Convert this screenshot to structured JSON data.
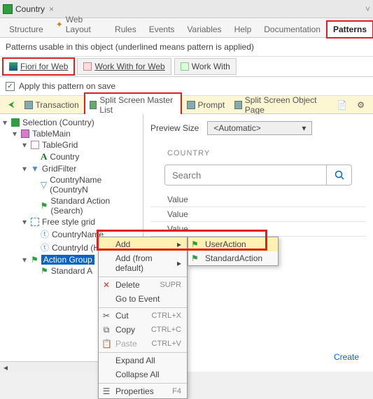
{
  "window": {
    "title": "Country",
    "close": "×",
    "collapse": "˅"
  },
  "tabs": {
    "items": [
      "Structure",
      "Web Layout",
      "Rules",
      "Events",
      "Variables",
      "Help",
      "Documentation",
      "Patterns"
    ],
    "active": "Patterns"
  },
  "patterns": {
    "hint": "Patterns usable in this object (underlined means pattern is applied)",
    "items": [
      {
        "label": "Fiori for Web",
        "active": true,
        "underlined": true
      },
      {
        "label": "Work With for Web",
        "active": false,
        "underlined": false
      },
      {
        "label": "Work With",
        "active": false,
        "underlined": false
      }
    ],
    "apply": {
      "checked": true,
      "label": "Apply this pattern on save"
    }
  },
  "toolbar": {
    "items": [
      "Transaction",
      "Split Screen Master List",
      "Prompt",
      "Split Screen Object Page"
    ]
  },
  "tree": {
    "root": "Selection (Country)",
    "n1": "TableMain",
    "n2": "TableGrid",
    "n3": "Country",
    "n4": "GridFilter",
    "n5": "CountryName (CountryN",
    "n6": "Standard Action (Search)",
    "n7": "Free style grid",
    "n8": "CountryName",
    "n9": "CountryId (Hidden)",
    "n10": "Action Group",
    "n11": "Standard A"
  },
  "context": {
    "add": "Add",
    "add_default": "Add (from default)",
    "delete": "Delete",
    "delete_sc": "SUPR",
    "goto": "Go to Event",
    "cut": "Cut",
    "cut_sc": "CTRL+X",
    "copy": "Copy",
    "copy_sc": "CTRL+C",
    "paste": "Paste",
    "paste_sc": "CTRL+V",
    "expand": "Expand All",
    "collapse": "Collapse All",
    "props": "Properties",
    "props_sc": "F4"
  },
  "submenu": {
    "user": "UserAction",
    "std": "StandardAction"
  },
  "preview": {
    "sizelbl": "Preview Size",
    "sizeval": "<Automatic>",
    "section": "COUNTRY",
    "search_ph": "Search",
    "values": [
      "Value",
      "Value",
      "Value"
    ],
    "create": "Create"
  }
}
